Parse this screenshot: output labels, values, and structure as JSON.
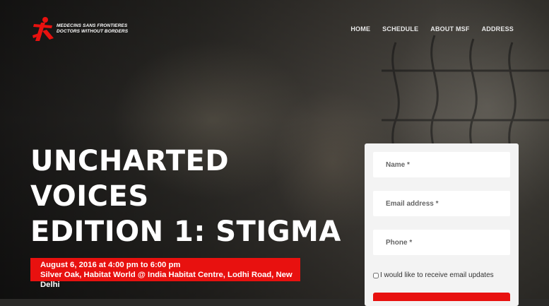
{
  "brand": {
    "line1": "MEDECINS SANS FRONTIERES",
    "line2": "DOCTORS WITHOUT BORDERS",
    "color": "#e8110f"
  },
  "nav": {
    "items": [
      "HOME",
      "SCHEDULE",
      "ABOUT MSF",
      "ADDRESS"
    ]
  },
  "hero": {
    "title_lines": [
      "UNCHARTED",
      "VOICES",
      "EDITION 1: STIGMA"
    ]
  },
  "event": {
    "datetime": "August 6, 2016 at 4:00 pm to 6:00 pm",
    "venue": "Silver Oak, Habitat World @ India Habitat Centre, Lodhi Road, New Delhi"
  },
  "form": {
    "name_placeholder": "Name *",
    "email_placeholder": "Email address *",
    "phone_placeholder": "Phone *",
    "optin_label": "I would like to receive email updates",
    "optin_checked": false
  }
}
